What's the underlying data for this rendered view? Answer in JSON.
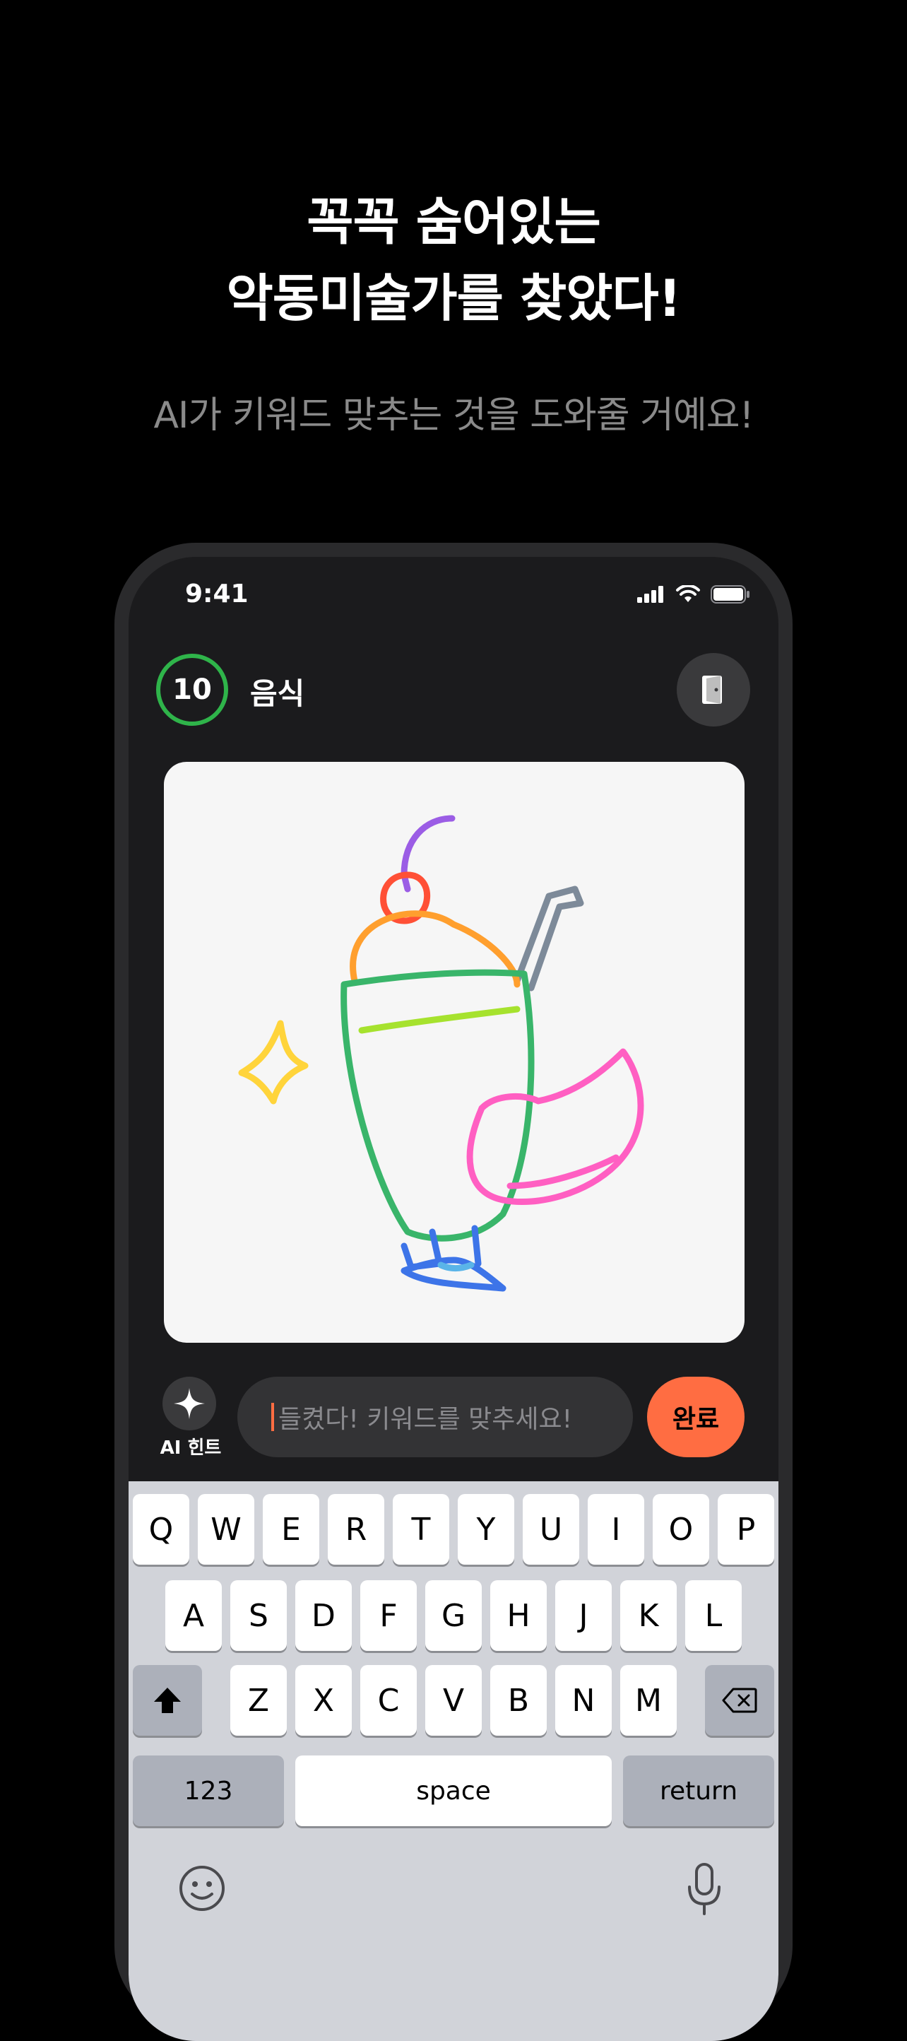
{
  "promo": {
    "headline_line1": "꼭꼭 숨어있는",
    "headline_line2": "악동미술가를 찾았다!",
    "subline": "AI가 키워드 맞추는 것을 도와줄 거예요!"
  },
  "status_bar": {
    "time": "9:41"
  },
  "game": {
    "timer_value": "10",
    "timer_progress": 1.0,
    "category": "음식",
    "hint_label": "AI 힌트",
    "guess_placeholder": "들켰다! 키워드를 맞추세요!",
    "done_label": "완료"
  },
  "keyboard": {
    "row1": [
      "Q",
      "W",
      "E",
      "R",
      "T",
      "Y",
      "U",
      "I",
      "O",
      "P"
    ],
    "row2": [
      "A",
      "S",
      "D",
      "F",
      "G",
      "H",
      "J",
      "K",
      "L"
    ],
    "row3": [
      "Z",
      "X",
      "C",
      "V",
      "B",
      "N",
      "M"
    ],
    "numbers_label": "123",
    "space_label": "space",
    "return_label": "return"
  },
  "colors": {
    "accent": "#ff6d42",
    "timer_ring": "#2fb44a",
    "background": "#000000",
    "screen": "#1b1b1d"
  },
  "icons": [
    "signal-icon",
    "wifi-icon",
    "battery-icon",
    "exit-door-icon",
    "sparkle-icon",
    "emoji-icon",
    "microphone-icon",
    "shift-icon",
    "backspace-icon"
  ]
}
